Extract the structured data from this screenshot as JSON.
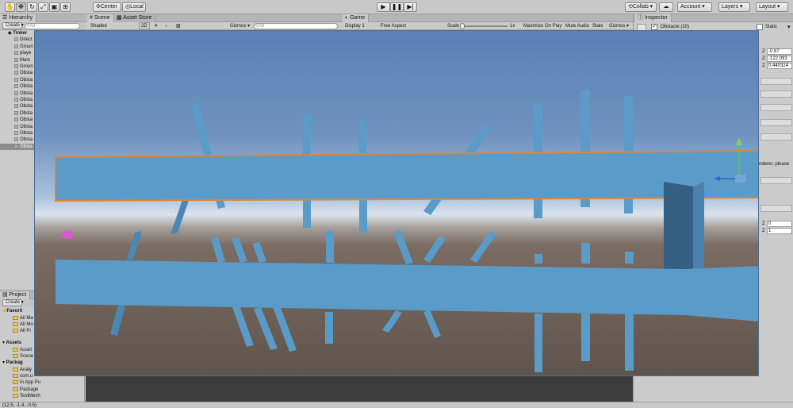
{
  "toolbar": {
    "pivot": "Center",
    "space": "Local",
    "collab": "Collab ▾",
    "account": "Account",
    "layers": "Layers",
    "layout": "Layout"
  },
  "hierarchy": {
    "tab": "Hierarchy",
    "create": "Create",
    "search_placeholder": "All",
    "scene_name": "Tinker",
    "items": [
      "Direct",
      "Groun",
      "playe",
      "Main",
      "Groun",
      "Obsta",
      "Obsta",
      "Obsta",
      "Obsta",
      "Obsta",
      "Obsta",
      "Obsta",
      "Obsta",
      "Obsta",
      "Obsta",
      "Obsta",
      "Obsta"
    ]
  },
  "scene": {
    "tab_scene": "Scene",
    "tab_store": "Asset Store",
    "shading": "Shaded",
    "mode_2d": "2D",
    "gizmos": "Gizmos ▾",
    "search_placeholder": "All"
  },
  "game": {
    "tab": "Game",
    "display": "Display 1",
    "aspect": "Free Aspect",
    "scale_label": "Scale",
    "scale_value": "1x",
    "maximize": "Maximize On Play",
    "mute": "Mute Audio",
    "stats": "Stats",
    "gizmos": "Gizmos ▾"
  },
  "inspector": {
    "tab": "Inspector",
    "object_name": "Obstacle (10)",
    "static_label": "Static",
    "z_labels": [
      "Z",
      "Z",
      "Z"
    ],
    "z_values": [
      "-0.87",
      "-122.093",
      "0.440324"
    ],
    "note": "nderer, please",
    "bottom_z": [
      "Z",
      "Z"
    ],
    "bottom_values": [
      "0",
      "1"
    ]
  },
  "project": {
    "tab": "Project",
    "create": "Create",
    "favorites_label": "Favorit",
    "favorites": [
      "All Ma",
      "All Mo",
      "All Pr"
    ],
    "assets_label": "Assets",
    "assets": [
      "Asset",
      "Scene"
    ],
    "packages_label": "Packag",
    "packages": [
      "Analy",
      "com.u",
      "In App Pu",
      "Package",
      "TextMesh"
    ]
  },
  "status": {
    "text": "(12.5, -1.4, -0.5)"
  },
  "colors": {
    "beam": "#5a9bc9",
    "selection_outline": "#e0852f",
    "sky_top": "#5d82b5",
    "ground": "#6b5d53"
  }
}
